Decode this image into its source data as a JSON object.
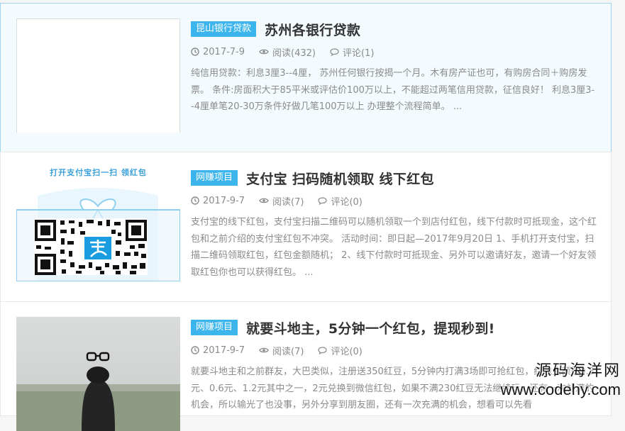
{
  "posts": [
    {
      "category": "昆山银行贷款",
      "title": "苏州各银行贷款",
      "date": "2017-7-9",
      "views": "阅读(432)",
      "comments": "评论(1)",
      "excerpt": "纯信用贷款：利息3厘3--4厘， 苏州任何银行按揭一个月。木有房产证也可，有购房合同＋购房发票。 条件:房面积大于85平米或评估价100万以上，不能超过两笔信用贷款，征信良好！ 利息3厘3--4厘单笔20-30万条件好做几笔100万以上 办理整个流程简单。 ..."
    },
    {
      "category": "网赚项目",
      "title": "支付宝 扫码随机领取 线下红包",
      "date": "2017-9-7",
      "views": "阅读(7)",
      "comments": "评论(0)",
      "excerpt": "支付宝的线下红包，支付宝扫描二维码可以随机领取一个到店付红包，线下付款时可抵现金，这个红包和之前介绍的支付宝红包不冲突。 活动时间：即日起—2017年9月20日 1、手机打开支付宝，扫描二维码领取红包，红包金额随机； 2、线下付款时可抵现金、另外可以邀请好友，邀请一个好友领取红包你也可以获得红包。 ...",
      "thumb_caption": "打开支付宝扫一扫 领红包"
    },
    {
      "category": "网赚项目",
      "title": "就要斗地主，5分钟一个红包，提现秒到!",
      "date": "2017-9-7",
      "views": "阅读(7)",
      "comments": "评论(0)",
      "excerpt": "就要斗地主和之前群友，大巴类似，注册送350红豆，5分钟内打满3场即可抢红包，红包金额是0.3元、0.6元、1.2元其中之一，2元兑换到微信红包，如果不满230红豆无法继续玩，还有一次补满的机会，所以输光了也没事，另外分享到朋友圈，还有一次充满的机会，想看可以先看"
    }
  ],
  "watermark": {
    "line1": "源码海洋网",
    "line2": "www.codehy.com"
  },
  "colors": {
    "accent": "#3cb5ec",
    "active_border": "#9fd3ef"
  },
  "icons": [
    "clock-icon",
    "eye-icon",
    "comment-icon",
    "qr-code-icon",
    "alipay-logo-icon"
  ]
}
